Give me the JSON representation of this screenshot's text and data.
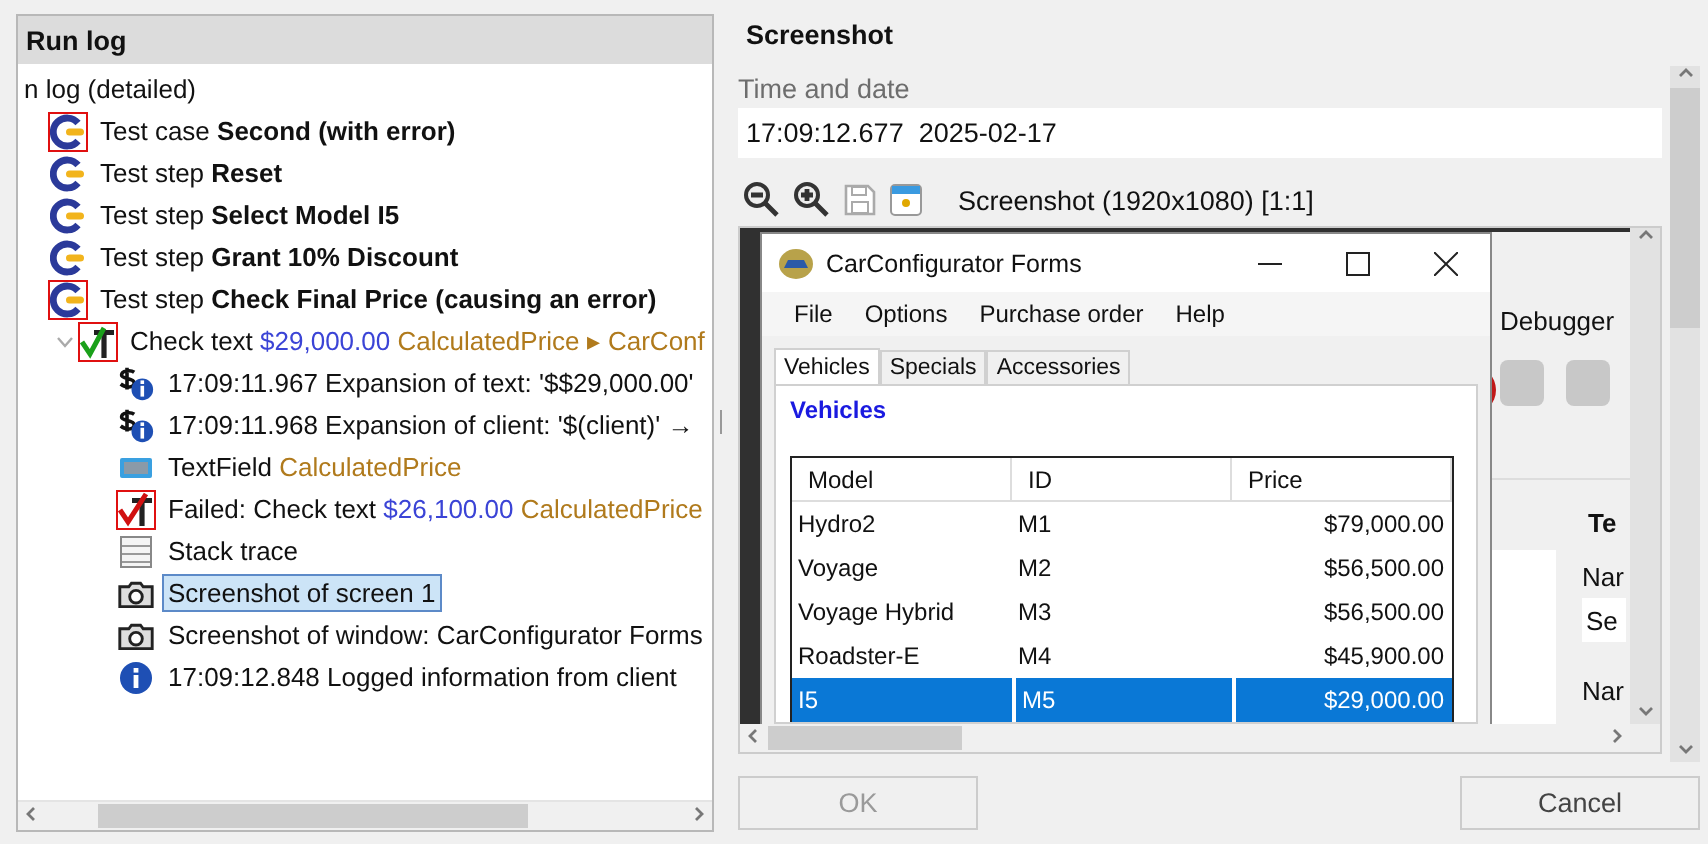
{
  "run_log": {
    "title": "Run log",
    "tree": [
      {
        "segments": [
          {
            "text": "n log (detailed)",
            "kind": "plain"
          }
        ],
        "selected": false,
        "children": [
          {
            "segments": [
              {
                "text": "Test case ",
                "kind": "plain"
              },
              {
                "text": "Second (with error)",
                "kind": "bold"
              }
            ],
            "kind": "test-step",
            "selected": false,
            "error": true,
            "children": [
              {
                "segments": [
                  {
                    "text": "Test step ",
                    "kind": "plain"
                  },
                  {
                    "text": "Reset",
                    "kind": "bold"
                  }
                ],
                "kind": "test-step",
                "selected": false,
                "error": false
              },
              {
                "segments": [
                  {
                    "text": "Test step ",
                    "kind": "plain"
                  },
                  {
                    "text": "Select Model I5",
                    "kind": "bold"
                  }
                ],
                "kind": "test-step",
                "selected": false,
                "error": false
              },
              {
                "segments": [
                  {
                    "text": "Test step ",
                    "kind": "plain"
                  },
                  {
                    "text": "Grant 10% Discount",
                    "kind": "bold"
                  }
                ],
                "kind": "test-step",
                "selected": false,
                "error": false
              },
              {
                "segments": [
                  {
                    "text": "Test step ",
                    "kind": "plain"
                  },
                  {
                    "text": "Check Final Price (causing an error)",
                    "kind": "bold"
                  }
                ],
                "kind": "test-step",
                "selected": false,
                "error": true,
                "children": [
                  {
                    "segments": [
                      {
                        "text": "Check text ",
                        "kind": "plain"
                      },
                      {
                        "text": "$29,000.00",
                        "kind": "value"
                      },
                      {
                        "text": " CalculatedPrice ▸ CarConf",
                        "kind": "component"
                      }
                    ],
                    "kind": "check-text",
                    "selected": false,
                    "error": true,
                    "expanded": true,
                    "children": [
                      {
                        "segments": [
                          {
                            "text": "17:09:11.967 Expansion of text: '$$29,000.00'",
                            "kind": "plain"
                          }
                        ],
                        "kind": "expansion",
                        "selected": false,
                        "error": false
                      },
                      {
                        "segments": [
                          {
                            "text": "17:09:11.968 Expansion of client: '$(client)' →",
                            "kind": "plain"
                          }
                        ],
                        "kind": "expansion",
                        "selected": false,
                        "error": false
                      },
                      {
                        "segments": [
                          {
                            "text": "TextField ",
                            "kind": "plain"
                          },
                          {
                            "text": "CalculatedPrice",
                            "kind": "component"
                          }
                        ],
                        "kind": "textfield",
                        "selected": false,
                        "error": false
                      },
                      {
                        "segments": [
                          {
                            "text": "Failed: Check text ",
                            "kind": "plain"
                          },
                          {
                            "text": "$26,100.00",
                            "kind": "value"
                          },
                          {
                            "text": " CalculatedPrice",
                            "kind": "component"
                          }
                        ],
                        "kind": "failed",
                        "selected": false,
                        "error": true
                      },
                      {
                        "segments": [
                          {
                            "text": "Stack trace",
                            "kind": "plain"
                          }
                        ],
                        "kind": "stack",
                        "selected": false,
                        "error": false
                      },
                      {
                        "segments": [
                          {
                            "text": "Screenshot of screen 1",
                            "kind": "plain"
                          }
                        ],
                        "kind": "camera",
                        "selected": true,
                        "error": false
                      },
                      {
                        "segments": [
                          {
                            "text": "Screenshot of window: CarConfigurator Forms",
                            "kind": "plain"
                          }
                        ],
                        "kind": "camera",
                        "selected": false,
                        "error": false
                      },
                      {
                        "segments": [
                          {
                            "text": "17:09:12.848 Logged information from client",
                            "kind": "plain"
                          }
                        ],
                        "kind": "info",
                        "selected": false,
                        "error": false
                      }
                    ]
                  }
                ]
              }
            ]
          }
        ]
      }
    ]
  },
  "screenshot": {
    "title": "Screenshot",
    "time_label": "Time and date",
    "time_value": "17:09:12.677  2025-02-17",
    "caption": "Screenshot (1920x1080) [1:1]",
    "background_app": {
      "toolbar_label": "Debugger",
      "section_title": "Te",
      "field_labels": [
        "Nar",
        "Nar"
      ],
      "field_value": "Se"
    },
    "window": {
      "title": "CarConfigurator Forms",
      "menu": [
        "File",
        "Options",
        "Purchase order",
        "Help"
      ],
      "tabs": [
        {
          "label": "Vehicles",
          "selected": true
        },
        {
          "label": "Specials",
          "selected": false
        },
        {
          "label": "Accessories",
          "selected": false
        }
      ],
      "heading": "Vehicles",
      "table": {
        "columns": [
          "Model",
          "ID",
          "Price"
        ],
        "rows": [
          {
            "cells": [
              "Hydro2",
              "M1",
              "$79,000.00"
            ],
            "selected": false
          },
          {
            "cells": [
              "Voyage",
              "M2",
              "$56,500.00"
            ],
            "selected": false
          },
          {
            "cells": [
              "Voyage Hybrid",
              "M3",
              "$56,500.00"
            ],
            "selected": false
          },
          {
            "cells": [
              "Roadster-E",
              "M4",
              "$45,900.00"
            ],
            "selected": false
          },
          {
            "cells": [
              "I5",
              "M5",
              "$29,000.00"
            ],
            "selected": true
          }
        ]
      }
    }
  },
  "buttons": [
    {
      "label": "OK",
      "disabled": true
    },
    {
      "label": "Cancel",
      "disabled": false
    }
  ]
}
